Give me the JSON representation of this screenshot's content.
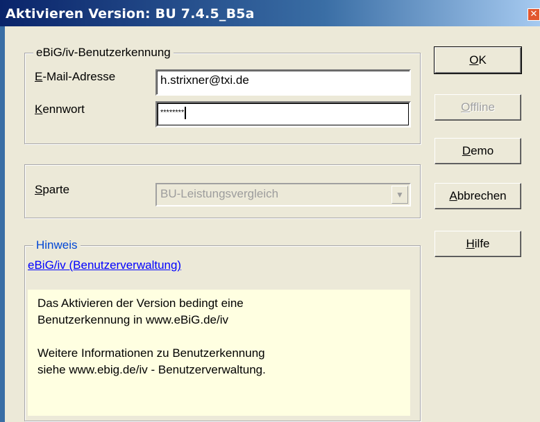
{
  "window": {
    "title": "Aktivieren Version: BU 7.4.5_B5a",
    "close_glyph": "✕"
  },
  "credentials": {
    "legend": "eBiG/iv-Benutzerkennung",
    "email_label": "E-Mail-Adresse",
    "email_value": "h.strixner@txi.de",
    "password_label": "Kennwort",
    "password_value": "********"
  },
  "sparte": {
    "label": "Sparte",
    "value": "BU-Leistungsvergleich"
  },
  "hinweis": {
    "legend": "Hinweis",
    "link": "eBiG/iv (Benutzerverwaltung)",
    "para1_line1": "Das Aktivieren der Version bedingt eine",
    "para1_line2": "Benutzerkennung in www.eBiG.de/iv",
    "para2_line1": "Weitere Informationen zu Benutzerkennung",
    "para2_line2": "siehe www.ebig.de/iv - Benutzerverwaltung."
  },
  "buttons": {
    "ok": "OK",
    "offline": "Offline",
    "demo": "Demo",
    "cancel": "Abbrechen",
    "help": "Hilfe"
  },
  "colors": {
    "titlebar_start": "#0A246A",
    "titlebar_end": "#A6CAF0",
    "note_bg": "#FFFFE1",
    "link": "#0000FF",
    "hinweis_legend": "#0046D5"
  }
}
